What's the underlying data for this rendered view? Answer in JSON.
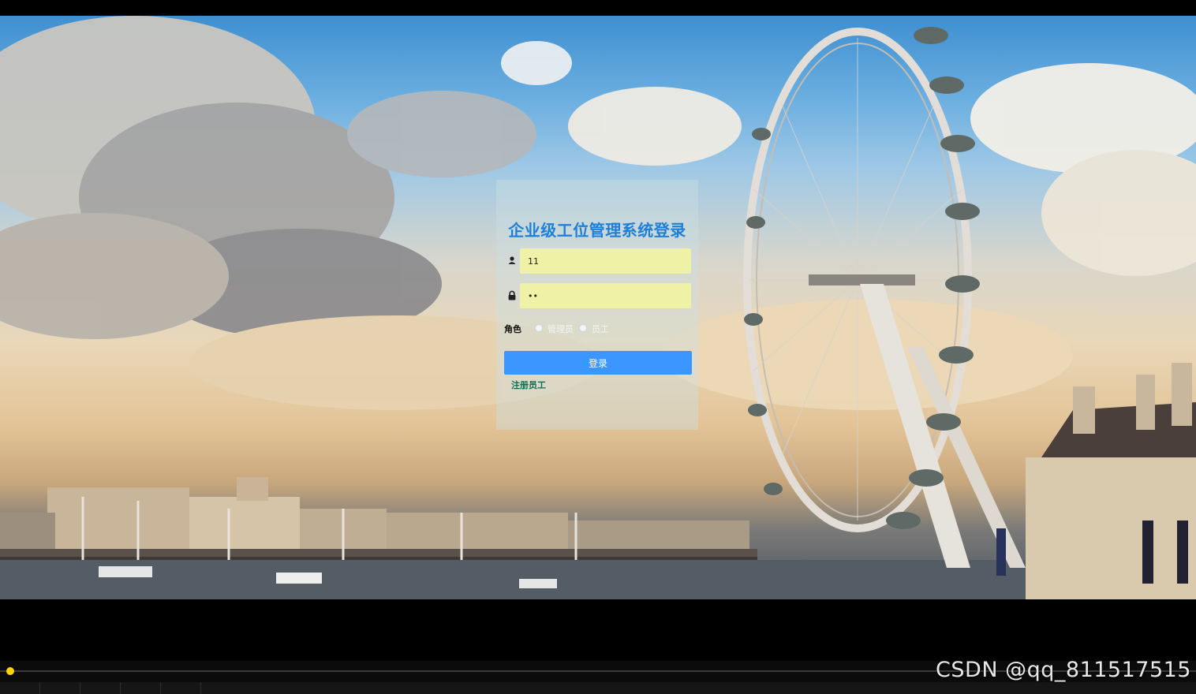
{
  "login": {
    "title": "企业级工位管理系统登录",
    "username_value": "11",
    "password_value": "••",
    "role_label": "角色",
    "role_options": [
      "管理员",
      "员工"
    ],
    "login_button": "登录",
    "register_link": "注册员工"
  },
  "icons": {
    "username": "user-icon",
    "password": "lock-icon"
  },
  "player": {
    "progress": 0.0
  },
  "watermark": "CSDN @qq_811517515",
  "colors": {
    "title": "#1e7fd8",
    "input_bg": "#eef1a6",
    "button": "#3b97ff",
    "register": "#0b6f55",
    "progress_knob": "#ffd400"
  }
}
